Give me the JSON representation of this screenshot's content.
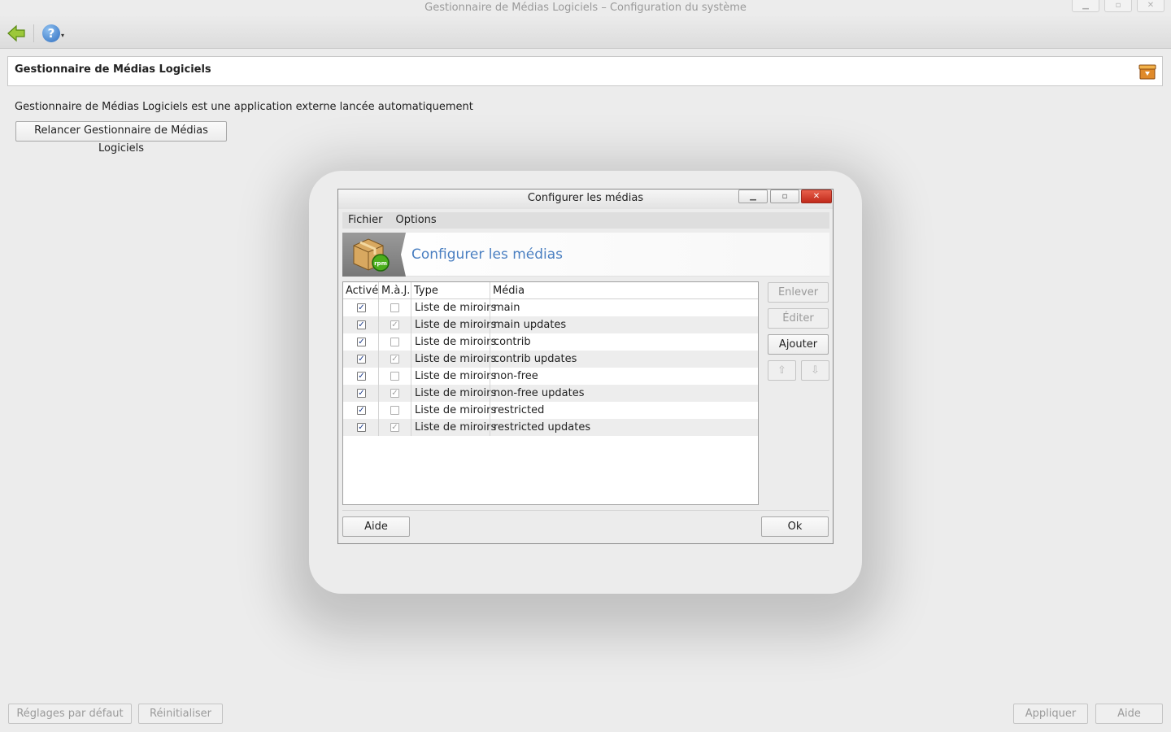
{
  "window": {
    "title": "Gestionnaire de Médias Logiciels – Configuration du système",
    "controls": {
      "minimize": "▁",
      "maximize": "▫",
      "close": "✕"
    }
  },
  "toolbar": {
    "back_icon": "back-arrow-icon",
    "help_icon": "help-icon",
    "help_glyph": "?",
    "help_dropdown_glyph": "▾"
  },
  "module": {
    "title": "Gestionnaire de Médias Logiciels",
    "icon": "package-manager-icon",
    "description": "Gestionnaire de Médias Logiciels est une application externe lancée automatiquement",
    "relaunch_button": "Relancer Gestionnaire de Médias Logiciels"
  },
  "dialog": {
    "title": "Configurer les médias",
    "controls": {
      "minimize": "▁",
      "maximize": "▫",
      "close": "✕"
    },
    "menu": [
      "Fichier",
      "Options"
    ],
    "banner_title": "Configurer les médias",
    "banner_icon": "rpm-package-icon",
    "columns": [
      "Activé",
      "M.à.J.",
      "Type",
      "Média"
    ],
    "rows": [
      {
        "active": true,
        "update": false,
        "type": "Liste de miroirs",
        "media": "main"
      },
      {
        "active": true,
        "update": true,
        "type": "Liste de miroirs",
        "media": "main updates"
      },
      {
        "active": true,
        "update": false,
        "type": "Liste de miroirs",
        "media": "contrib"
      },
      {
        "active": true,
        "update": true,
        "type": "Liste de miroirs",
        "media": "contrib updates"
      },
      {
        "active": true,
        "update": false,
        "type": "Liste de miroirs",
        "media": "non-free"
      },
      {
        "active": true,
        "update": true,
        "type": "Liste de miroirs",
        "media": "non-free updates"
      },
      {
        "active": true,
        "update": false,
        "type": "Liste de miroirs",
        "media": "restricted"
      },
      {
        "active": true,
        "update": true,
        "type": "Liste de miroirs",
        "media": "restricted updates"
      }
    ],
    "buttons": {
      "remove": "Enlever",
      "edit": "Éditer",
      "add": "Ajouter",
      "move_up_icon": "arrow-up-icon",
      "move_down_icon": "arrow-down-icon",
      "move_up_glyph": "⇧",
      "move_down_glyph": "⇩",
      "help": "Aide",
      "ok": "Ok"
    }
  },
  "footer": {
    "defaults_button": "Réglages par défaut",
    "reset_button": "Réinitialiser",
    "apply_button": "Appliquer",
    "help_button": "Aide"
  }
}
